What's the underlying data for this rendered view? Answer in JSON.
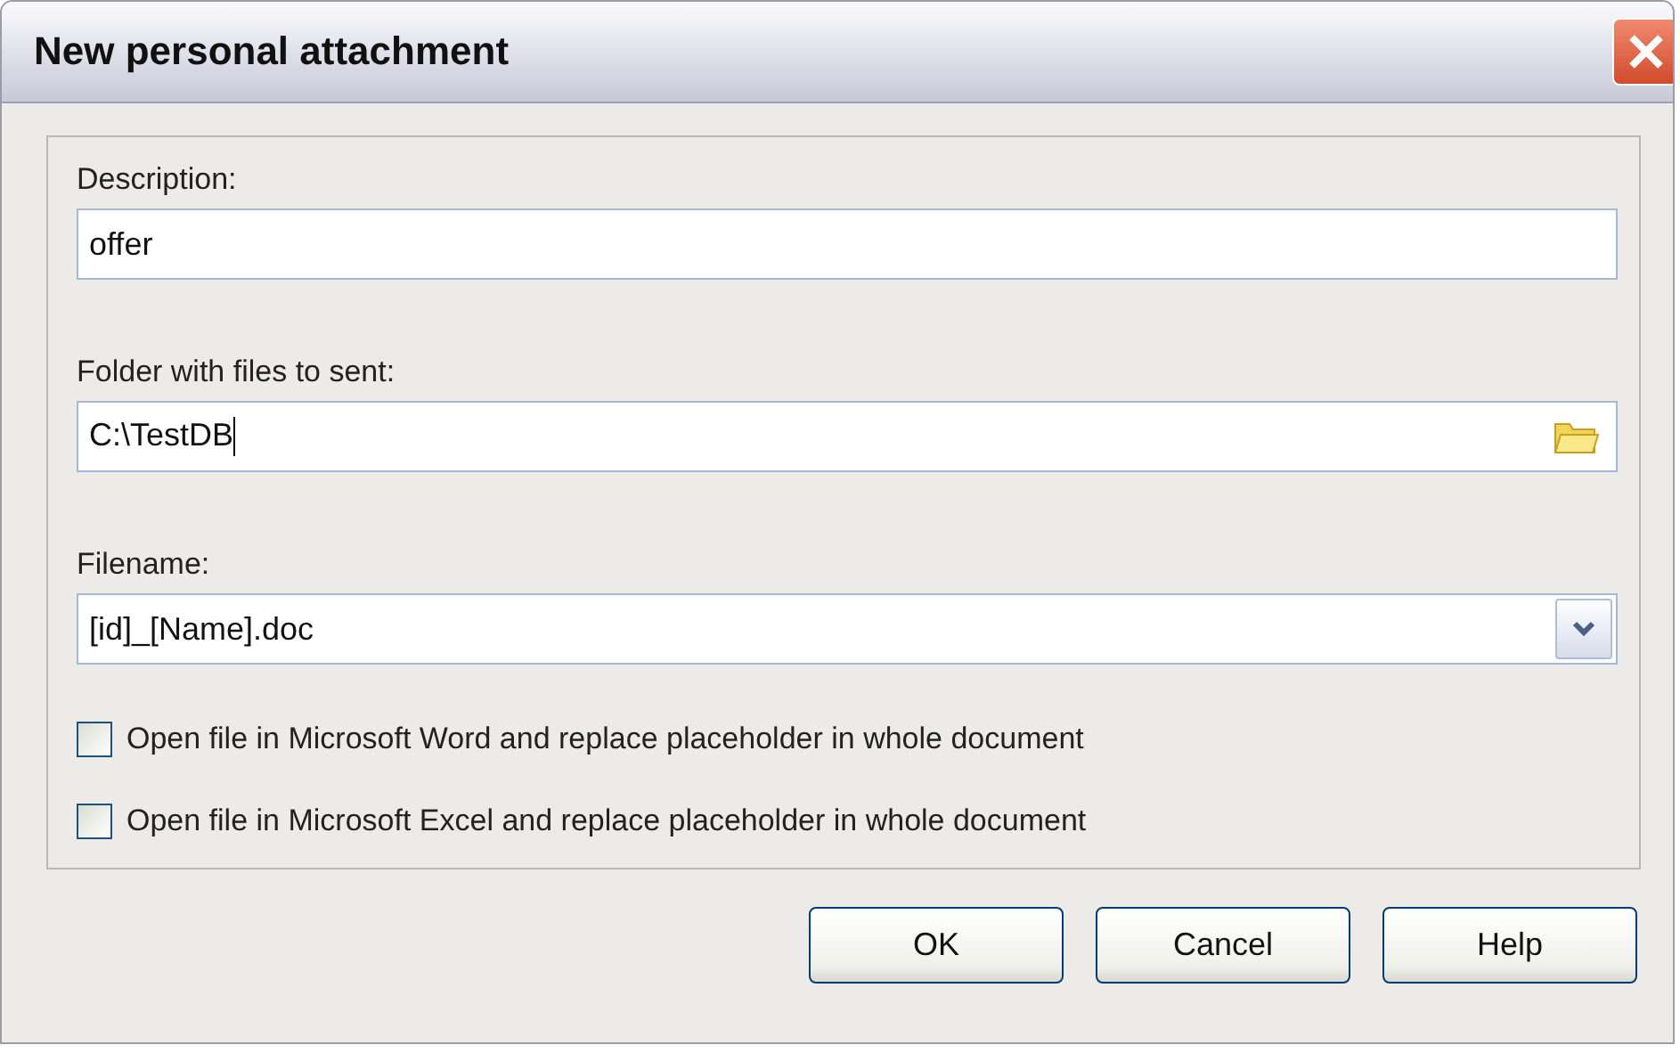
{
  "window": {
    "title": "New personal attachment"
  },
  "fields": [
    {
      "kind": "text",
      "label": "Description:",
      "value": "offer"
    },
    {
      "kind": "folder",
      "label": "Folder with files to sent:",
      "value": "C:\\TestDB"
    },
    {
      "kind": "combo",
      "label": "Filename:",
      "value": "[id]_[Name].doc"
    }
  ],
  "options": [
    {
      "label": "Open file in Microsoft Word and replace placeholder in whole document",
      "checked": false
    },
    {
      "label": "Open file in Microsoft Excel and replace placeholder in whole document",
      "checked": false
    }
  ],
  "buttons": [
    "OK",
    "Cancel",
    "Help"
  ]
}
